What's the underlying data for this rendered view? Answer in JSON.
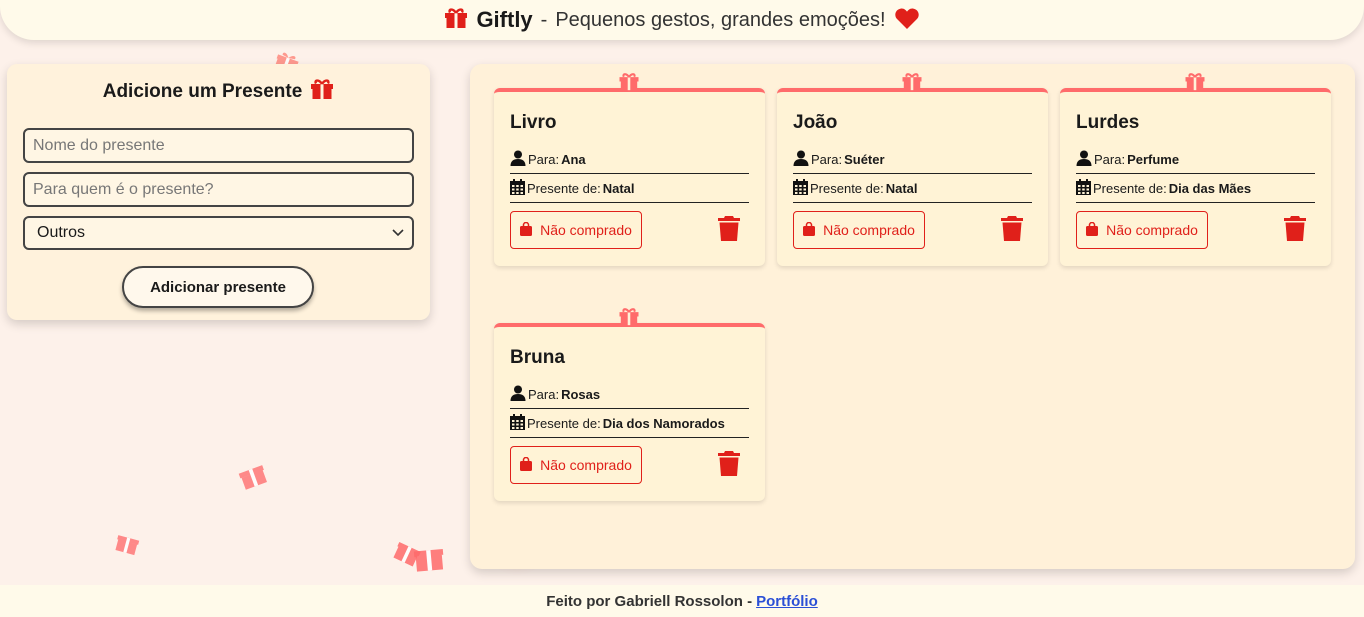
{
  "header": {
    "brand": "Giftly",
    "separator": "-",
    "tagline": "Pequenos gestos, grandes emoções!"
  },
  "form": {
    "title": "Adicione um Presente",
    "name_placeholder": "Nome do presente",
    "recipient_placeholder": "Para quem é o presente?",
    "occasion_selected": "Outros",
    "submit_label": "Adicionar presente"
  },
  "cards": [
    {
      "title": "Livro",
      "to_label": "Para:",
      "to": "Ana",
      "occasion_label": "Presente de:",
      "occasion": "Natal",
      "status": "Não comprado"
    },
    {
      "title": "João",
      "to_label": "Para:",
      "to": "Suéter",
      "occasion_label": "Presente de:",
      "occasion": "Natal",
      "status": "Não comprado"
    },
    {
      "title": "Lurdes",
      "to_label": "Para:",
      "to": "Perfume",
      "occasion_label": "Presente de:",
      "occasion": "Dia das Mães",
      "status": "Não comprado"
    },
    {
      "title": "Bruna",
      "to_label": "Para:",
      "to": "Rosas",
      "occasion_label": "Presente de:",
      "occasion": "Dia dos Namorados",
      "status": "Não comprado"
    }
  ],
  "footer": {
    "text": "Feito por Gabriell Rossolon -",
    "link": "Portfólio"
  },
  "colors": {
    "accent": "#e0201a",
    "card_top": "#ff6b6b",
    "panel": "#fff1d9"
  },
  "icons": [
    "gift-icon",
    "heart-icon",
    "user-icon",
    "calendar-icon",
    "shopping-bag-icon",
    "trash-icon",
    "chevron-down-icon"
  ]
}
